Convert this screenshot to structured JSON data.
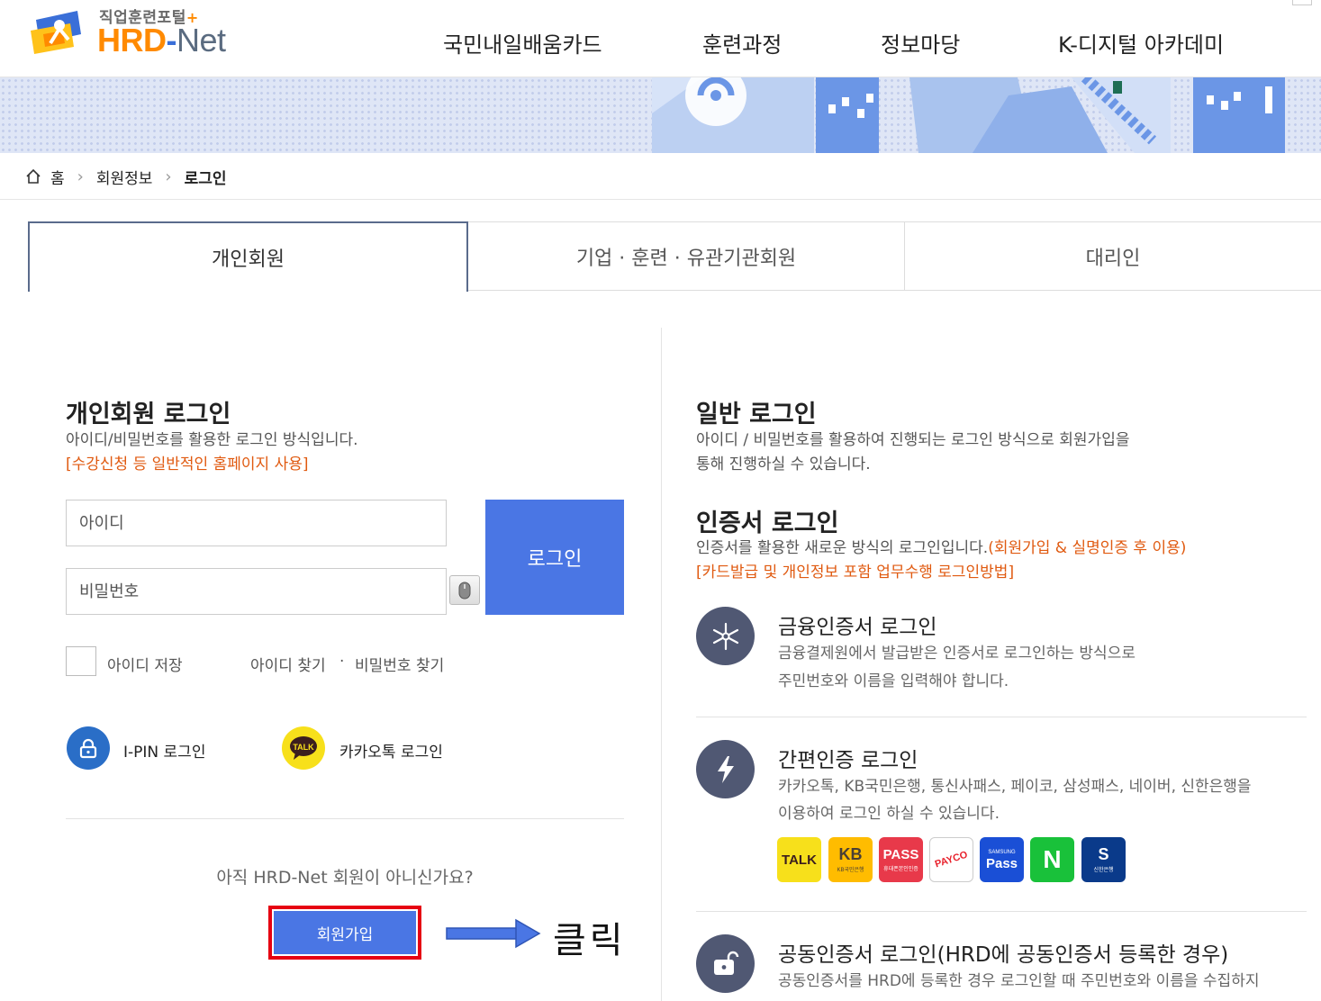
{
  "header": {
    "logo_sub": "직업훈련포털",
    "logo_plus": "+",
    "logo_hrd": "HRD",
    "logo_dash": "-",
    "logo_net": "Net",
    "nav": [
      "국민내일배움카드",
      "훈련과정",
      "정보마당",
      "K-디지털 아카데미"
    ]
  },
  "breadcrumb": {
    "home": "홈",
    "section": "회원정보",
    "current": "로그인"
  },
  "tabs": [
    "개인회원",
    "기업 · 훈련 · 유관기관회원",
    "대리인"
  ],
  "left": {
    "title": "개인회원 로그인",
    "desc": "아이디/비밀번호를 활용한 로그인 방식입니다.",
    "desc_orange": "[수강신청 등 일반적인 홈페이지 사용]",
    "id_placeholder": "아이디",
    "pw_placeholder": "비밀번호",
    "login_button": "로그인",
    "save_id": "아이디 저장",
    "find_id": "아이디 찾기",
    "dot": "·",
    "find_pw": "비밀번호 찾기",
    "ipin_login": "I-PIN 로그인",
    "kakao_login": "카카오톡 로그인",
    "kakao_icon_text": "TALK",
    "not_member": "아직 HRD-Net 회원이 아니신가요?",
    "join_button": "회원가입",
    "click_note": "클릭"
  },
  "right": {
    "general_title": "일반 로그인",
    "general_desc1": "아이디 / 비밀번호를 활용하여 진행되는 로그인 방식으로 회원가입을",
    "general_desc2": "통해 진행하실 수 있습니다.",
    "cert_title": "인증서 로그인",
    "cert_desc": "인증서를 활용한 새로운 방식의 로그인입니다.",
    "cert_desc_orange1": "(회원가입 & 실명인증 후 이용)",
    "cert_desc_orange2": "[카드발급 및 개인정보 포함 업무수행 로그인방법]",
    "fin_title": "금융인증서 로그인",
    "fin_desc1": "금융결제원에서 발급받은 인증서로 로그인하는 방식으로",
    "fin_desc2": "주민번호와 이름을 입력해야 합니다.",
    "simple_title": "간편인증 로그인",
    "simple_desc1": "카카오톡, KB국민은행, 통신사패스, 페이코, 삼성패스, 네이버, 신한은행을",
    "simple_desc2": "이용하여 로그인 하실 수 있습니다.",
    "providers": [
      {
        "label": "TALK",
        "bg": "#f7e01b",
        "color": "#3b1e1e"
      },
      {
        "label": "KB",
        "sub": "KB국민은행",
        "bg": "#ffbc00",
        "color": "#4a3f35"
      },
      {
        "label": "PASS",
        "sub": "휴대폰본인인증",
        "bg": "#e8394a",
        "color": "#ffffff"
      },
      {
        "label": "PAYCO",
        "bg": "#ffffff",
        "color": "#e8222d"
      },
      {
        "label": "Pass",
        "sub": "SAMSUNG",
        "bg": "#1a4fd6",
        "color": "#ffffff"
      },
      {
        "label": "N",
        "bg": "#19c13a",
        "color": "#ffffff"
      },
      {
        "label": "S",
        "sub": "신한은행",
        "bg": "#0a3a8a",
        "color": "#ffffff"
      }
    ],
    "joint_title": "공동인증서 로그인(HRD에 공동인증서 등록한 경우)",
    "joint_desc": "공동인증서를 HRD에 등록한 경우 로그인할 때 주민번호와 이름을 수집하지"
  }
}
